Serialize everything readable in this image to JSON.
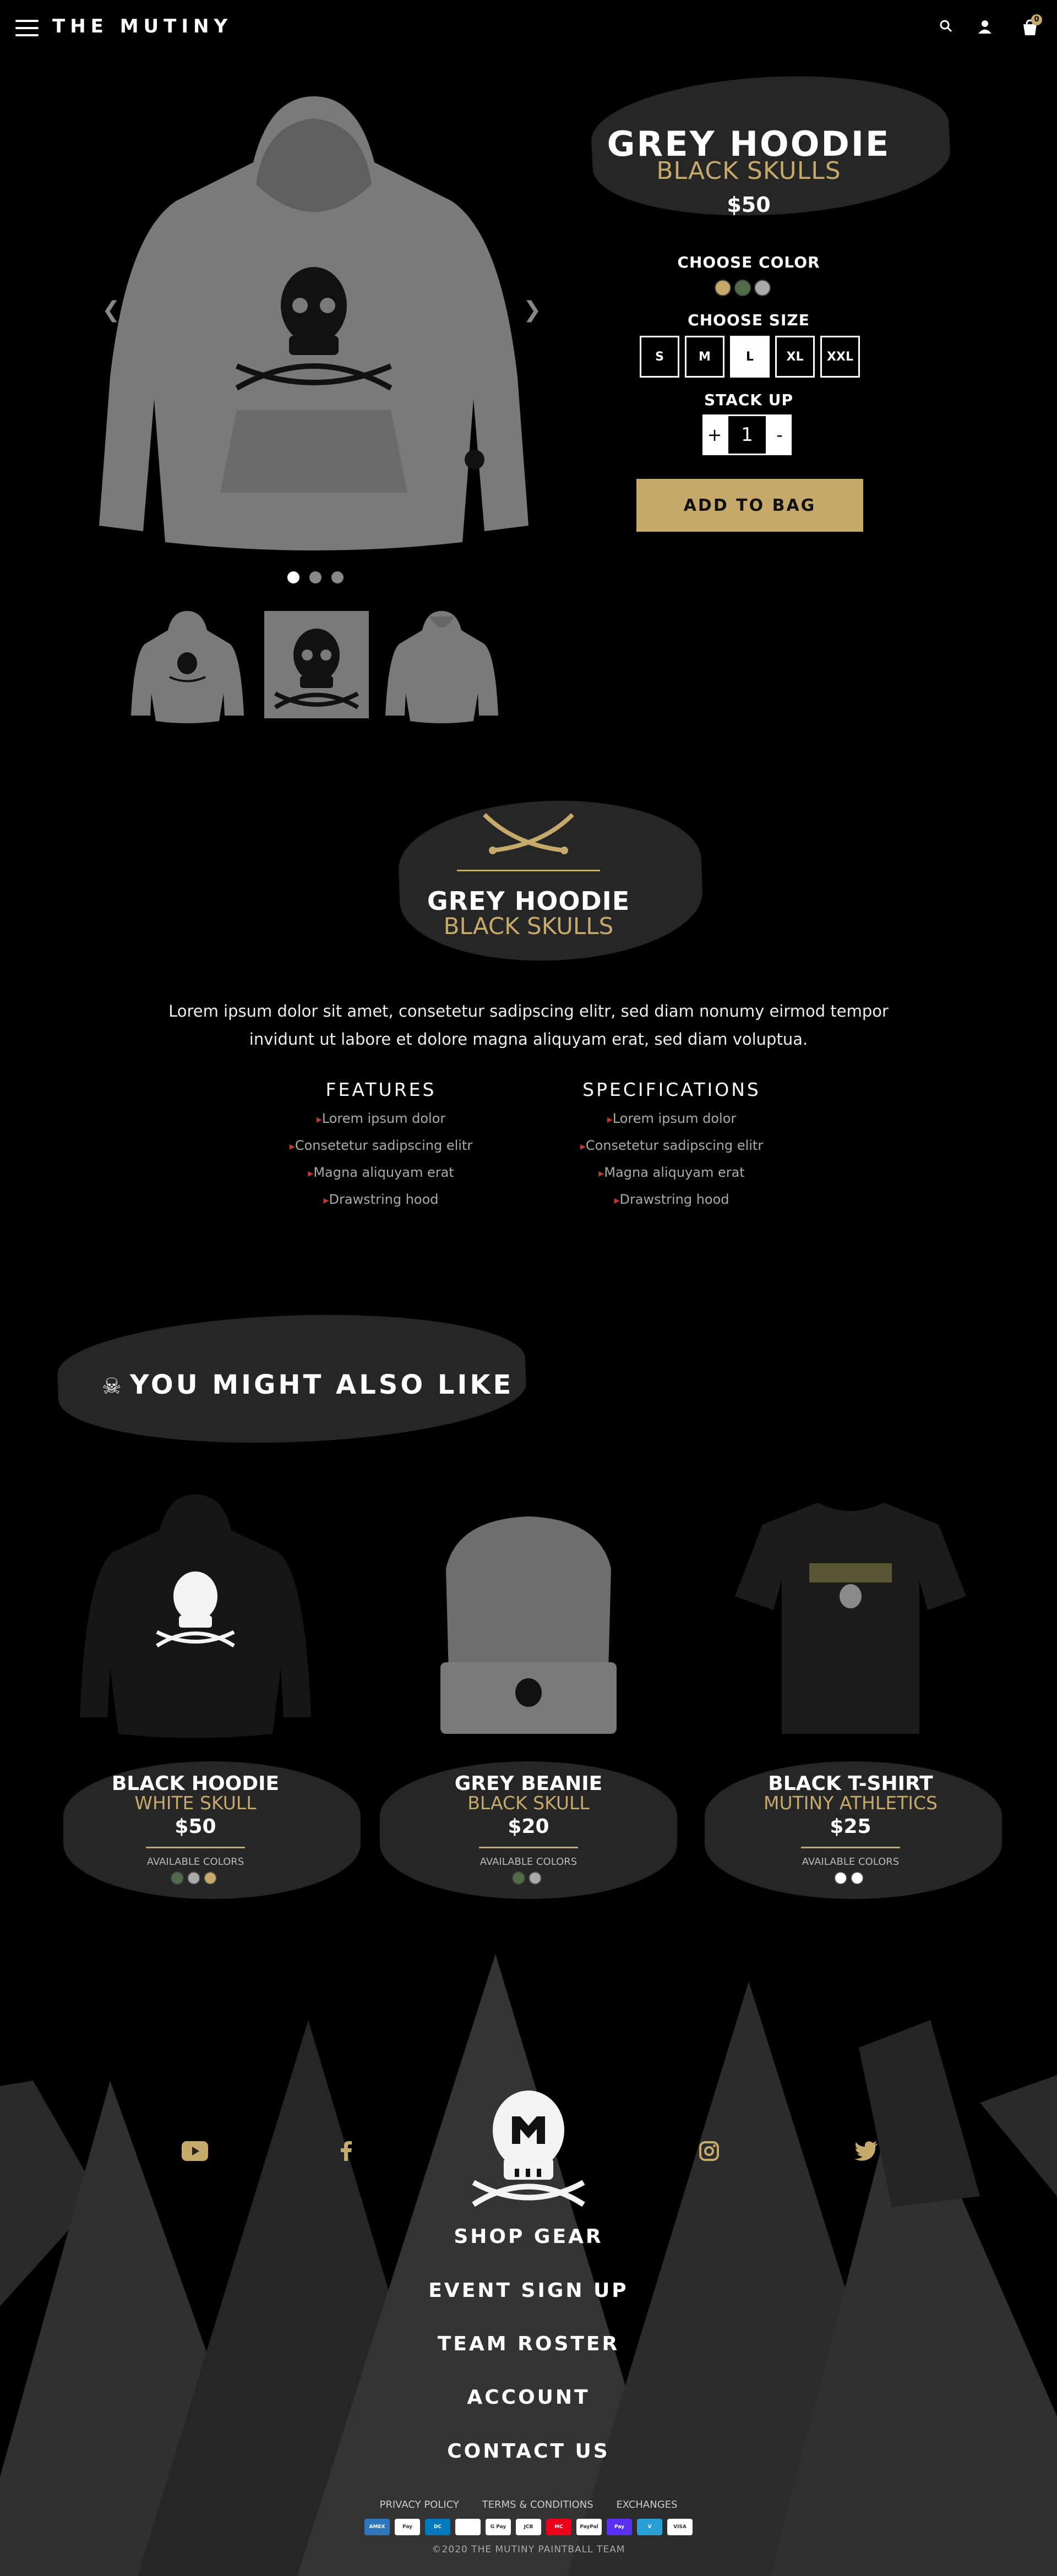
{
  "header": {
    "brand": "THE MUTINY",
    "cart_count": "0"
  },
  "product": {
    "title": "GREY HOODIE",
    "subtitle": "BLACK SKULLS",
    "price": "$50",
    "choose_color_label": "CHOOSE COLOR",
    "colors": [
      "#c6aa6b",
      "#4f6b48",
      "#aaaaaa"
    ],
    "choose_size_label": "CHOOSE SIZE",
    "sizes": [
      "S",
      "M",
      "L",
      "XL",
      "XXL"
    ],
    "selected_size": "L",
    "stack_up_label": "STACK UP",
    "quantity": "1",
    "plus": "+",
    "minus": "-",
    "add_to_bag": "ADD TO BAG",
    "carousel_dots": 3,
    "carousel_active": 0
  },
  "details": {
    "title": "GREY HOODIE",
    "subtitle": "BLACK SKULLS",
    "description": "Lorem ipsum dolor sit amet, consetetur sadipscing elitr, sed diam nonumy eirmod tempor invidunt ut labore et dolore magna aliquyam erat, sed diam voluptua.",
    "features_heading": "FEATURES",
    "features": [
      "Lorem ipsum dolor",
      "Consetetur sadipscing elitr",
      "Magna aliquyam erat",
      "Drawstring hood"
    ],
    "specs_heading": "SPECIFICATIONS",
    "specs": [
      "Lorem ipsum dolor",
      "Consetetur sadipscing elitr",
      "Magna aliquyam erat",
      "Drawstring hood"
    ]
  },
  "related": {
    "heading": "YOU MIGHT ALSO LIKE",
    "available_label": "AVAILABLE COLORS",
    "items": [
      {
        "title": "BLACK HOODIE",
        "subtitle": "WHITE SKULL",
        "price": "$50",
        "colors": [
          "#4f6b48",
          "#aaaaaa",
          "#c6aa6b"
        ]
      },
      {
        "title": "GREY BEANIE",
        "subtitle": "BLACK SKULL",
        "price": "$20",
        "colors": [
          "#4f6b48",
          "#aaaaaa"
        ]
      },
      {
        "title": "BLACK T-SHIRT",
        "subtitle": "MUTINY ATHLETICS",
        "price": "$25",
        "colors": [
          "#ffffff",
          "#ffffff"
        ]
      }
    ]
  },
  "footer": {
    "nav": [
      "SHOP GEAR",
      "EVENT SIGN UP",
      "TEAM ROSTER",
      "ACCOUNT",
      "CONTACT US"
    ],
    "links": [
      "PRIVACY POLICY",
      "TERMS & CONDITIONS",
      "EXCHANGES"
    ],
    "payments": [
      "AMEX",
      "Pay",
      "DC",
      "",
      "G Pay",
      "JCB",
      "MC",
      "PayPal",
      "Pay",
      "V",
      "VISA"
    ],
    "copyright": "©2020 THE MUTINY PAINTBALL TEAM"
  },
  "colors": {
    "gold": "#c6aa6b",
    "background": "#000000",
    "brush": "#262626",
    "bullet": "#c0392b"
  },
  "icons": [
    "menu-icon",
    "search-icon",
    "user-icon",
    "cart-icon",
    "chevron-left-icon",
    "chevron-right-icon",
    "skull-icon",
    "youtube-icon",
    "facebook-icon",
    "instagram-icon",
    "twitter-icon"
  ]
}
